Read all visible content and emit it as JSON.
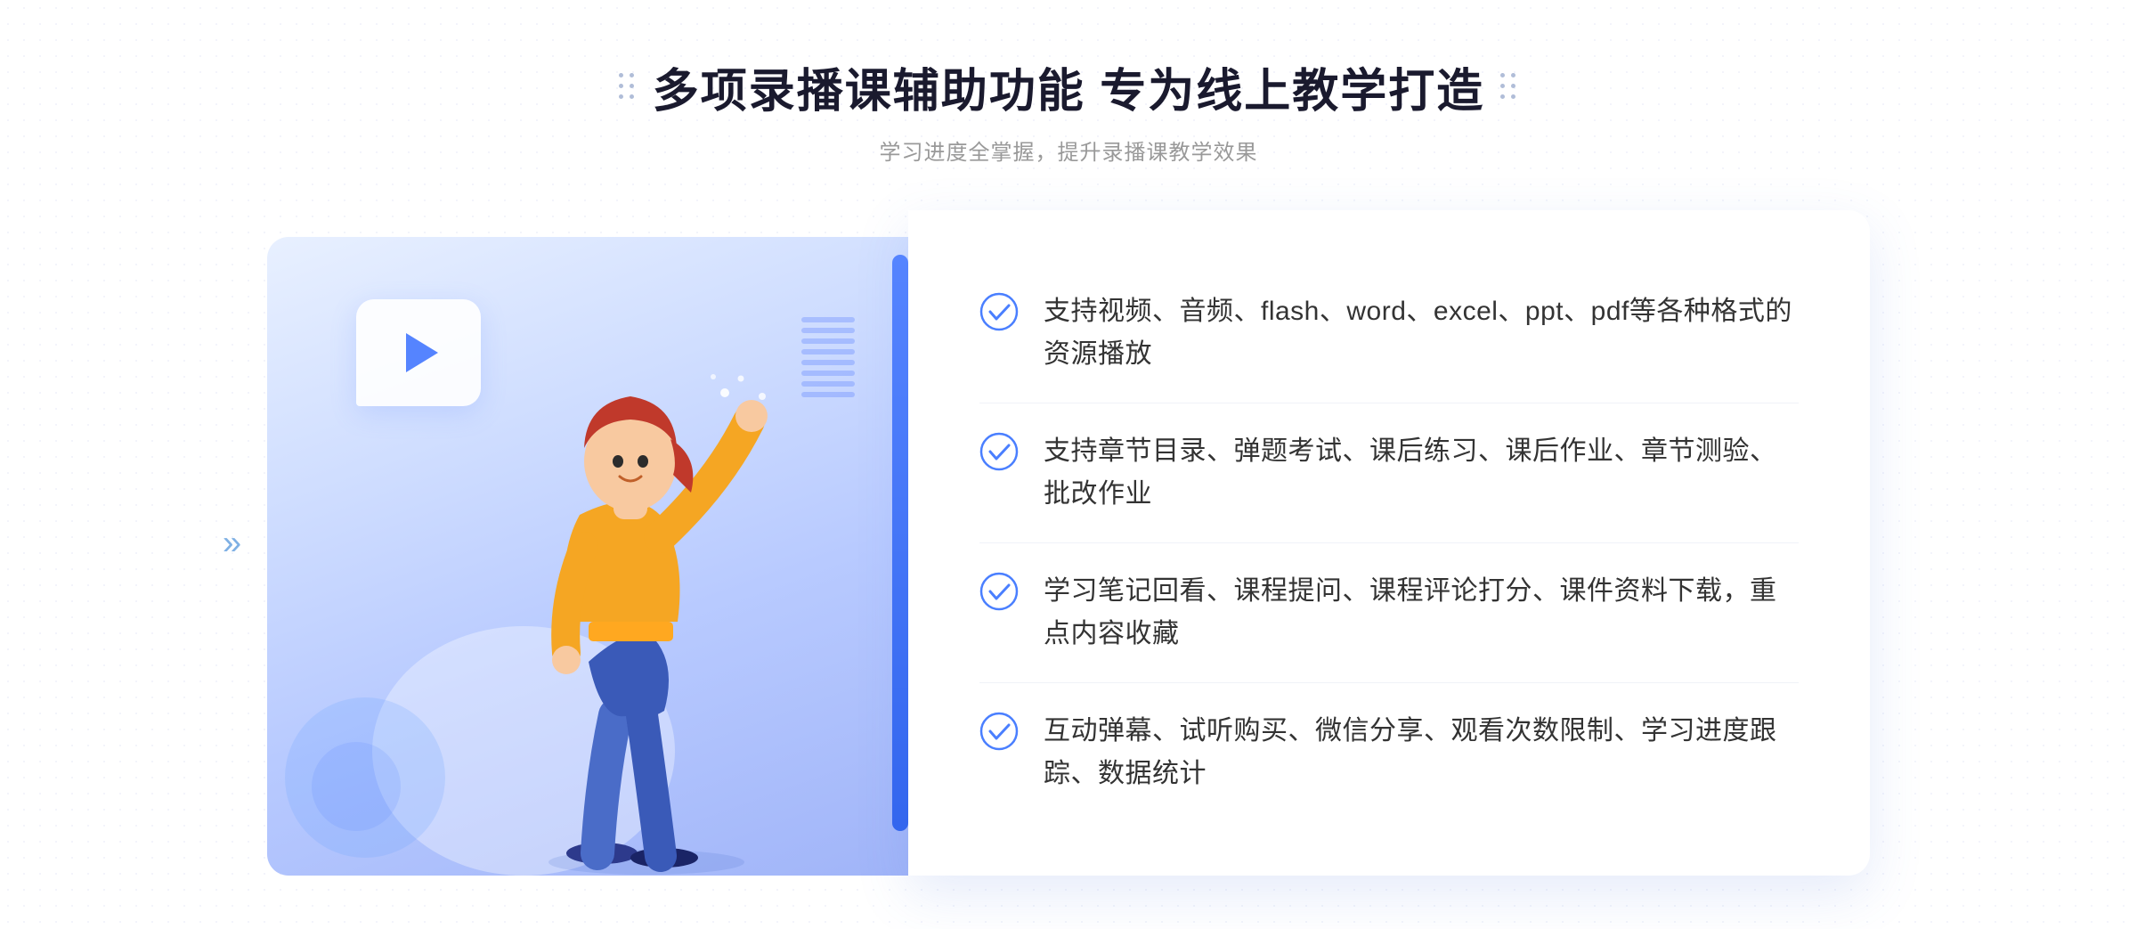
{
  "header": {
    "title": "多项录播课辅助功能 专为线上教学打造",
    "subtitle": "学习进度全掌握，提升录播课教学效果"
  },
  "features": [
    {
      "id": "feature-1",
      "text": "支持视频、音频、flash、word、excel、ppt、pdf等各种格式的资源播放"
    },
    {
      "id": "feature-2",
      "text": "支持章节目录、弹题考试、课后练习、课后作业、章节测验、批改作业"
    },
    {
      "id": "feature-3",
      "text": "学习笔记回看、课程提问、课程评论打分、课件资料下载，重点内容收藏"
    },
    {
      "id": "feature-4",
      "text": "互动弹幕、试听购买、微信分享、观看次数限制、学习进度跟踪、数据统计"
    }
  ],
  "icons": {
    "check": "✓",
    "play": "▶",
    "chevron_left": "«"
  },
  "colors": {
    "primary": "#4a7fff",
    "title": "#1a1a2e",
    "subtitle": "#999999",
    "text": "#333333",
    "check_color": "#4a7fff",
    "bg_gradient_start": "#e8f0ff",
    "bg_gradient_end": "#a0b4f8"
  }
}
